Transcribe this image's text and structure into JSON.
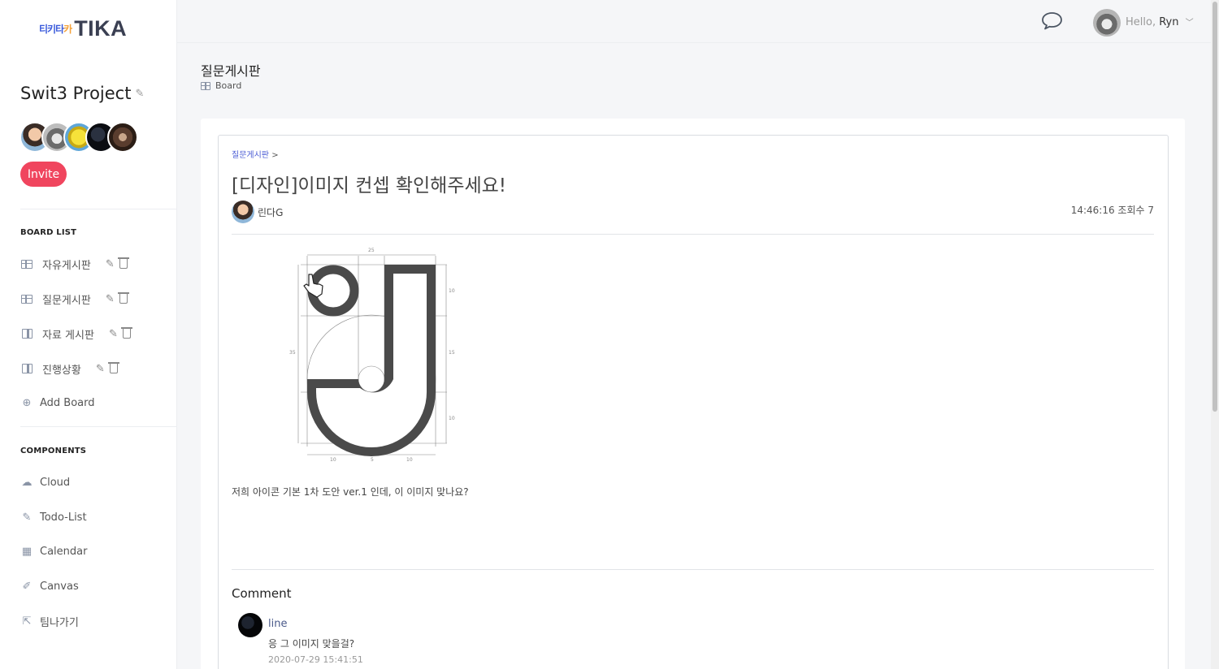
{
  "app": {
    "logo_kr_1": "티키",
    "logo_kr_2": "타",
    "logo_kr_3": "카",
    "logo_en": "TIKA"
  },
  "sidebar": {
    "project_title": "Swit3 Project",
    "invite_label": "Invite",
    "board_list_label": "BOARD LIST",
    "boards": [
      {
        "label": "자유게시판",
        "icon": "table-icon"
      },
      {
        "label": "질문게시판",
        "icon": "table-icon"
      },
      {
        "label": "자료 게시판",
        "icon": "book-icon"
      },
      {
        "label": "진행상황",
        "icon": "book-icon"
      }
    ],
    "add_board_label": "Add Board",
    "components_label": "COMPONENTS",
    "components": [
      {
        "label": "Cloud",
        "icon": "cloud-icon"
      },
      {
        "label": "Todo-List",
        "icon": "edit-icon"
      },
      {
        "label": "Calendar",
        "icon": "calendar-icon"
      },
      {
        "label": "Canvas",
        "icon": "brush-icon"
      },
      {
        "label": "팀나가기",
        "icon": "exit-icon"
      }
    ]
  },
  "header": {
    "greeting": "Hello,",
    "user_name": "Ryn"
  },
  "page": {
    "title": "질문게시판",
    "subtitle": "Board"
  },
  "post": {
    "breadcrumb": "질문게시판",
    "breadcrumb_sep": ">",
    "title": "[디자인]이미지 컨셉 확인해주세요!",
    "author": "린다G",
    "meta": "14:46:16 조회수 7",
    "body": "저희 아이콘 기본 1차 도안 ver.1 인데, 이 이미지 맞나요?",
    "figure_labels": {
      "top": "25",
      "left": "35",
      "right_1": "10",
      "right_2": "15",
      "right_3": "10",
      "bottom_1": "10",
      "bottom_2": "5",
      "bottom_3": "10"
    }
  },
  "comments": {
    "heading": "Comment",
    "items": [
      {
        "name": "line",
        "text": "응 그 이미지 맞을걸?",
        "date": "2020-07-29 15:41:51"
      }
    ]
  },
  "colors": {
    "accent": "#f0455e",
    "link": "#4a5bd4",
    "sidebar_bg": "#ffffff",
    "page_bg": "#f5f6f8"
  }
}
